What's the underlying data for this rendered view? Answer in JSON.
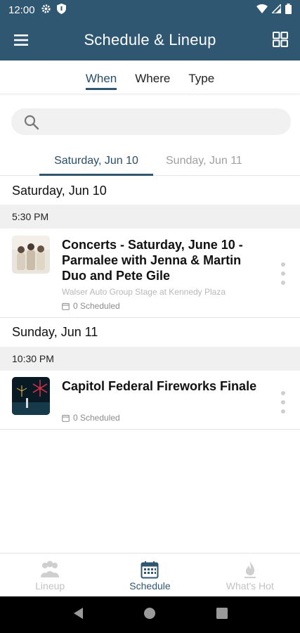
{
  "status": {
    "time": "12:00",
    "left_icons": [
      "gear-icon",
      "shield-icon"
    ],
    "right_icons": [
      "wifi-icon",
      "signal-icon",
      "battery-icon"
    ]
  },
  "appbar": {
    "title": "Schedule & Lineup",
    "menu_icon": "hamburger-menu-icon",
    "grid_icon": "grid-view-icon"
  },
  "filter_tabs": [
    {
      "label": "When",
      "active": true
    },
    {
      "label": "Where",
      "active": false
    },
    {
      "label": "Type",
      "active": false
    }
  ],
  "search": {
    "placeholder": "",
    "icon": "search-icon"
  },
  "date_tabs": [
    {
      "label": "Saturday, Jun 10",
      "active": true
    },
    {
      "label": "Sunday, Jun 11",
      "active": false
    }
  ],
  "schedule": [
    {
      "day": "Saturday, Jun 10",
      "time": "5:30 PM",
      "event": {
        "title": "Concerts - Saturday, June 10 - Parmalee with Jenna & Martin Duo and Pete Gile",
        "venue": "Walser Auto Group Stage at Kennedy Plaza",
        "scheduled": "0 Scheduled"
      }
    },
    {
      "day": "Sunday, Jun 11",
      "time": "10:30 PM",
      "event": {
        "title": "Capitol Federal Fireworks Finale",
        "venue": "",
        "scheduled": "0 Scheduled"
      }
    }
  ],
  "bottom_nav": [
    {
      "label": "Lineup",
      "icon": "people-icon",
      "active": false
    },
    {
      "label": "Schedule",
      "icon": "calendar-icon",
      "active": true
    },
    {
      "label": "What's Hot",
      "icon": "flame-icon",
      "active": false
    }
  ],
  "colors": {
    "primary": "#2f5772",
    "active_text": "#2a4d6a",
    "inactive_text": "#a0a0a0",
    "band_bg": "#f0f0f0"
  }
}
